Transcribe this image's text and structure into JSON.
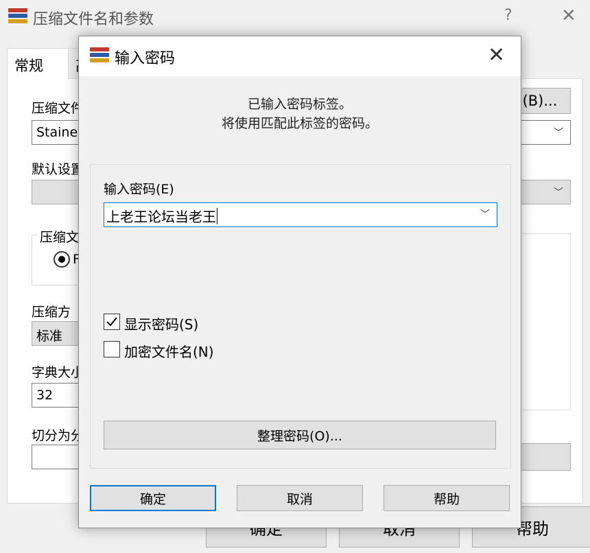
{
  "background_window": {
    "title": "压缩文件名和参数",
    "help_glyph": "?",
    "close_glyph": "✕",
    "tabs": [
      "常规",
      "高"
    ],
    "fields": {
      "archive_name_label": "压缩文件",
      "archive_name_value": "Stainec",
      "browse_button": "(B)...",
      "profile_label": "默认设置",
      "format_group_label": "压缩文",
      "format_radio_label": "F",
      "method_label": "压缩方",
      "method_value": "标准",
      "dict_label": "字典大小",
      "dict_value": "32",
      "split_label": "切分为分"
    },
    "buttons": {
      "ok": "确定",
      "cancel": "取消",
      "help": "帮助"
    }
  },
  "dialog": {
    "title": "输入密码",
    "close_glyph": "✕",
    "message_line1": "已输入密码标签。",
    "message_line2": "将使用匹配此标签的密码。",
    "password_label": "输入密码(E)",
    "password_value": "上老王论坛当老王",
    "show_password_label": "显示密码(S)",
    "show_password_checked": true,
    "encrypt_names_label": "加密文件名(N)",
    "encrypt_names_checked": false,
    "manage_button": "整理密码(O)...",
    "ok_button": "确定",
    "cancel_button": "取消",
    "help_button": "帮助"
  },
  "colors": {
    "accent": "#0078d7",
    "icon_red": "#c0392b",
    "icon_blue": "#2e5aa8",
    "icon_gold": "#d4a017"
  }
}
